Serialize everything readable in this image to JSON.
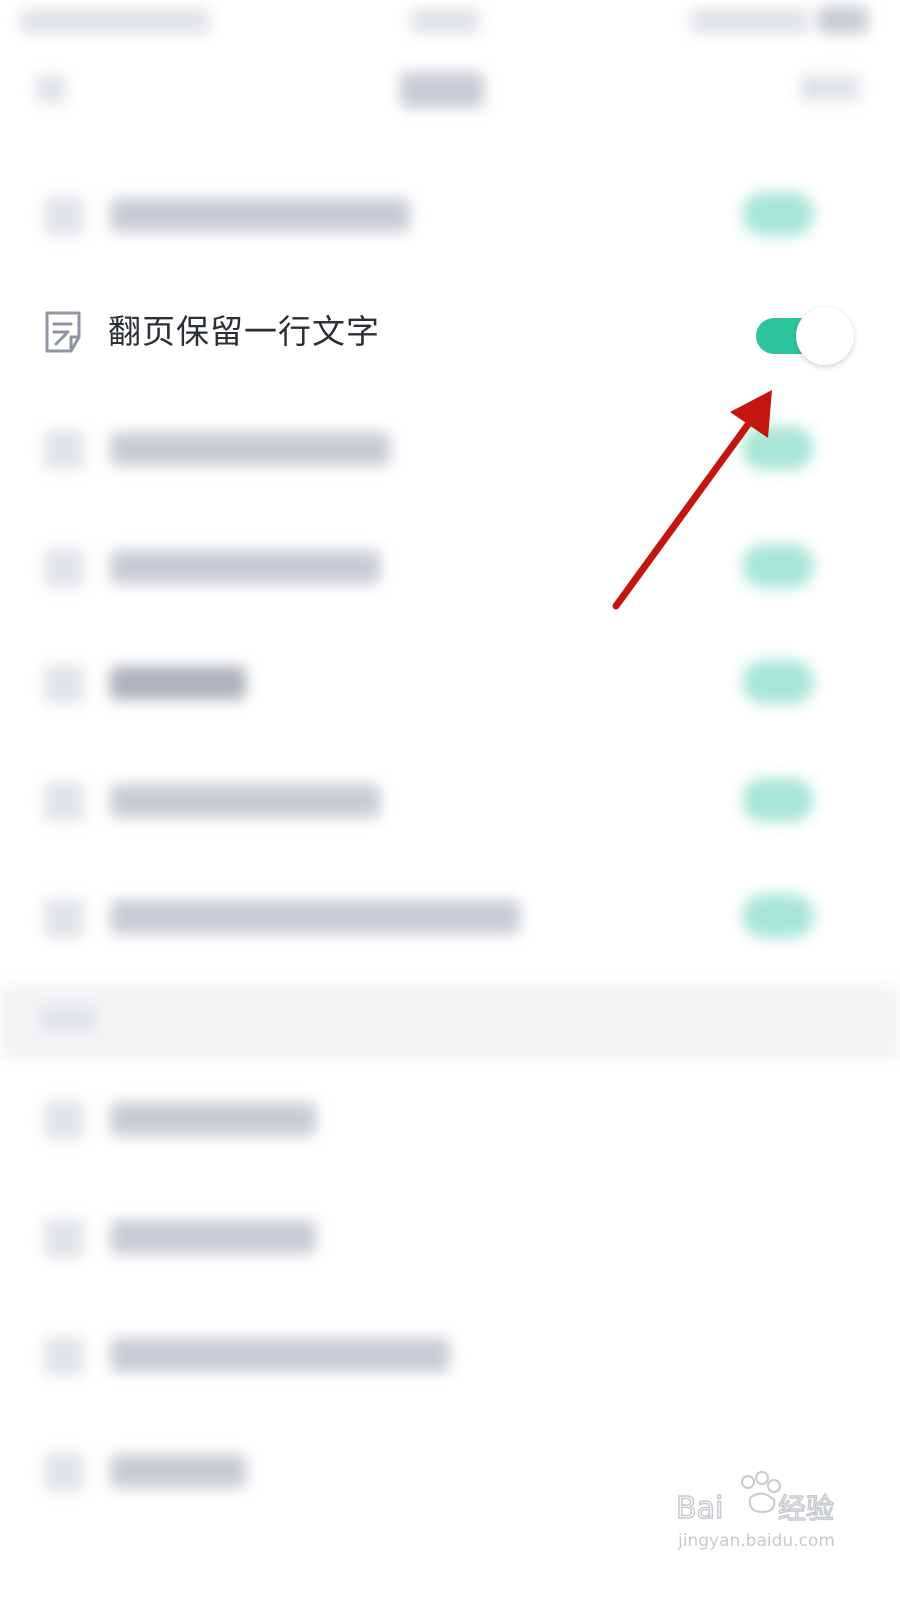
{
  "setting_row": {
    "label": "翻页保留一行文字",
    "icon": "page-note-icon",
    "toggle_on": true
  },
  "colors": {
    "toggle_on": "#2ec59e",
    "annotation_arrow": "#c4160f",
    "label_text": "#2b2f36"
  },
  "annotation": {
    "type": "arrow",
    "target": "toggle"
  },
  "watermark": {
    "brand_icon": "baidu-paw-logo",
    "text": "Bai经验",
    "url": "jingyan.baidu.com"
  }
}
